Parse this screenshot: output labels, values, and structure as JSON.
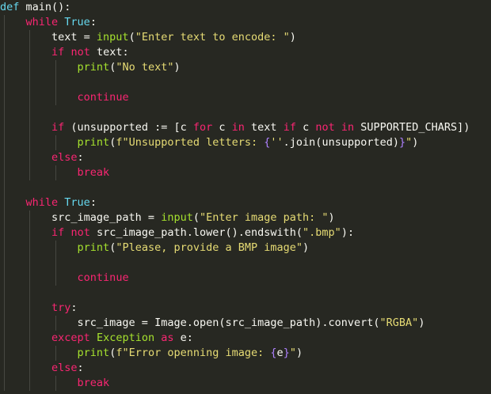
{
  "colors": {
    "background": "#272822",
    "plain": "#f8f8f2",
    "keyword": "#f92672",
    "function": "#a6e22e",
    "string": "#e6db74",
    "constant": "#ae81ff",
    "builtin": "#66d9ef",
    "indent_guide": "#464741"
  },
  "code": {
    "lines": [
      [
        {
          "t": "def",
          "c": "builtin"
        },
        {
          "t": " main():",
          "c": "plain"
        }
      ],
      [
        {
          "t": "    ",
          "c": "plain"
        },
        {
          "t": "while",
          "c": "kw"
        },
        {
          "t": " ",
          "c": "plain"
        },
        {
          "t": "True",
          "c": "builtin"
        },
        {
          "t": ":",
          "c": "plain"
        }
      ],
      [
        {
          "t": "        text = ",
          "c": "plain"
        },
        {
          "t": "input",
          "c": "fn"
        },
        {
          "t": "(",
          "c": "plain"
        },
        {
          "t": "\"Enter text to encode: \"",
          "c": "str"
        },
        {
          "t": ")",
          "c": "plain"
        }
      ],
      [
        {
          "t": "        ",
          "c": "plain"
        },
        {
          "t": "if",
          "c": "kw"
        },
        {
          "t": " ",
          "c": "plain"
        },
        {
          "t": "not",
          "c": "kw"
        },
        {
          "t": " text:",
          "c": "plain"
        }
      ],
      [
        {
          "t": "            ",
          "c": "plain"
        },
        {
          "t": "print",
          "c": "fn"
        },
        {
          "t": "(",
          "c": "plain"
        },
        {
          "t": "\"No text\"",
          "c": "str"
        },
        {
          "t": ")",
          "c": "plain"
        }
      ],
      [],
      [
        {
          "t": "            ",
          "c": "plain"
        },
        {
          "t": "continue",
          "c": "kw"
        }
      ],
      [],
      [
        {
          "t": "        ",
          "c": "plain"
        },
        {
          "t": "if",
          "c": "kw"
        },
        {
          "t": " (unsupported := [c ",
          "c": "plain"
        },
        {
          "t": "for",
          "c": "kw"
        },
        {
          "t": " c ",
          "c": "plain"
        },
        {
          "t": "in",
          "c": "kw"
        },
        {
          "t": " text ",
          "c": "plain"
        },
        {
          "t": "if",
          "c": "kw"
        },
        {
          "t": " c ",
          "c": "plain"
        },
        {
          "t": "not",
          "c": "kw"
        },
        {
          "t": " ",
          "c": "plain"
        },
        {
          "t": "in",
          "c": "kw"
        },
        {
          "t": " SUPPORTED_CHARS])",
          "c": "plain"
        }
      ],
      [
        {
          "t": "            ",
          "c": "plain"
        },
        {
          "t": "print",
          "c": "fn"
        },
        {
          "t": "(",
          "c": "plain"
        },
        {
          "t": "f\"Unsupported letters: ",
          "c": "str"
        },
        {
          "t": "{",
          "c": "const"
        },
        {
          "t": "''",
          "c": "str"
        },
        {
          "t": ".join(unsupported)",
          "c": "plain"
        },
        {
          "t": "}",
          "c": "const"
        },
        {
          "t": "\"",
          "c": "str"
        },
        {
          "t": ")",
          "c": "plain"
        }
      ],
      [
        {
          "t": "        ",
          "c": "plain"
        },
        {
          "t": "else",
          "c": "kw"
        },
        {
          "t": ":",
          "c": "plain"
        }
      ],
      [
        {
          "t": "            ",
          "c": "plain"
        },
        {
          "t": "break",
          "c": "kw"
        }
      ],
      [],
      [
        {
          "t": "    ",
          "c": "plain"
        },
        {
          "t": "while",
          "c": "kw"
        },
        {
          "t": " ",
          "c": "plain"
        },
        {
          "t": "True",
          "c": "builtin"
        },
        {
          "t": ":",
          "c": "plain"
        }
      ],
      [
        {
          "t": "        src_image_path = ",
          "c": "plain"
        },
        {
          "t": "input",
          "c": "fn"
        },
        {
          "t": "(",
          "c": "plain"
        },
        {
          "t": "\"Enter image path: \"",
          "c": "str"
        },
        {
          "t": ")",
          "c": "plain"
        }
      ],
      [
        {
          "t": "        ",
          "c": "plain"
        },
        {
          "t": "if",
          "c": "kw"
        },
        {
          "t": " ",
          "c": "plain"
        },
        {
          "t": "not",
          "c": "kw"
        },
        {
          "t": " src_image_path.lower().endswith(",
          "c": "plain"
        },
        {
          "t": "\".bmp\"",
          "c": "str"
        },
        {
          "t": "):",
          "c": "plain"
        }
      ],
      [
        {
          "t": "            ",
          "c": "plain"
        },
        {
          "t": "print",
          "c": "fn"
        },
        {
          "t": "(",
          "c": "plain"
        },
        {
          "t": "\"Please, provide a BMP image\"",
          "c": "str"
        },
        {
          "t": ")",
          "c": "plain"
        }
      ],
      [],
      [
        {
          "t": "            ",
          "c": "plain"
        },
        {
          "t": "continue",
          "c": "kw"
        }
      ],
      [],
      [
        {
          "t": "        ",
          "c": "plain"
        },
        {
          "t": "try",
          "c": "kw"
        },
        {
          "t": ":",
          "c": "plain"
        }
      ],
      [
        {
          "t": "            src_image = Image.open(src_image_path).convert(",
          "c": "plain"
        },
        {
          "t": "\"RGBA\"",
          "c": "str"
        },
        {
          "t": ")",
          "c": "plain"
        }
      ],
      [
        {
          "t": "        ",
          "c": "plain"
        },
        {
          "t": "except",
          "c": "kw"
        },
        {
          "t": " ",
          "c": "plain"
        },
        {
          "t": "Exception",
          "c": "fn"
        },
        {
          "t": " ",
          "c": "plain"
        },
        {
          "t": "as",
          "c": "kw"
        },
        {
          "t": " e:",
          "c": "plain"
        }
      ],
      [
        {
          "t": "            ",
          "c": "plain"
        },
        {
          "t": "print",
          "c": "fn"
        },
        {
          "t": "(",
          "c": "plain"
        },
        {
          "t": "f\"Error openning image: ",
          "c": "str"
        },
        {
          "t": "{",
          "c": "const"
        },
        {
          "t": "e",
          "c": "plain"
        },
        {
          "t": "}",
          "c": "const"
        },
        {
          "t": "\"",
          "c": "str"
        },
        {
          "t": ")",
          "c": "plain"
        }
      ],
      [
        {
          "t": "        ",
          "c": "plain"
        },
        {
          "t": "else",
          "c": "kw"
        },
        {
          "t": ":",
          "c": "plain"
        }
      ],
      [
        {
          "t": "            ",
          "c": "plain"
        },
        {
          "t": "break",
          "c": "kw"
        }
      ]
    ]
  }
}
